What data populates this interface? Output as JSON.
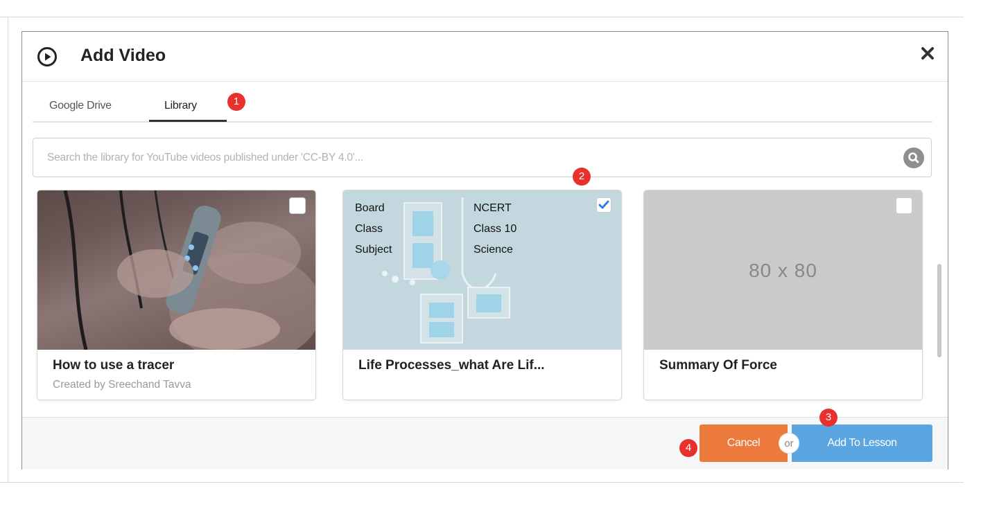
{
  "modal": {
    "title": "Add Video",
    "close_icon": "close-icon"
  },
  "tabs": [
    {
      "label": "Google Drive",
      "active": false
    },
    {
      "label": "Library",
      "active": true
    }
  ],
  "search": {
    "placeholder": "Search the library for YouTube videos published under 'CC-BY 4.0'...",
    "value": ""
  },
  "badges": {
    "b1": "1",
    "b2": "2",
    "b3": "3",
    "b4": "4"
  },
  "cards": [
    {
      "title": "How to use a tracer",
      "subtitle": "Created by Sreechand Tavva",
      "checked": false
    },
    {
      "title": "Life Processes_what Are Lif...",
      "subtitle": "",
      "checked": true,
      "thumbnail_meta": [
        {
          "label": "Board",
          "value": "NCERT"
        },
        {
          "label": "Class",
          "value": "Class 10"
        },
        {
          "label": "Subject",
          "value": "Science"
        }
      ]
    },
    {
      "title": "Summary Of Force",
      "subtitle": "",
      "checked": false,
      "placeholder_text": "80 x 80"
    }
  ],
  "footer": {
    "cancel_label": "Cancel",
    "or_label": "or",
    "add_label": "Add To Lesson"
  },
  "colors": {
    "cancel": "#ec7a3d",
    "add": "#5ba6e0",
    "badge": "#e8312c",
    "check": "#2f7fe0"
  }
}
